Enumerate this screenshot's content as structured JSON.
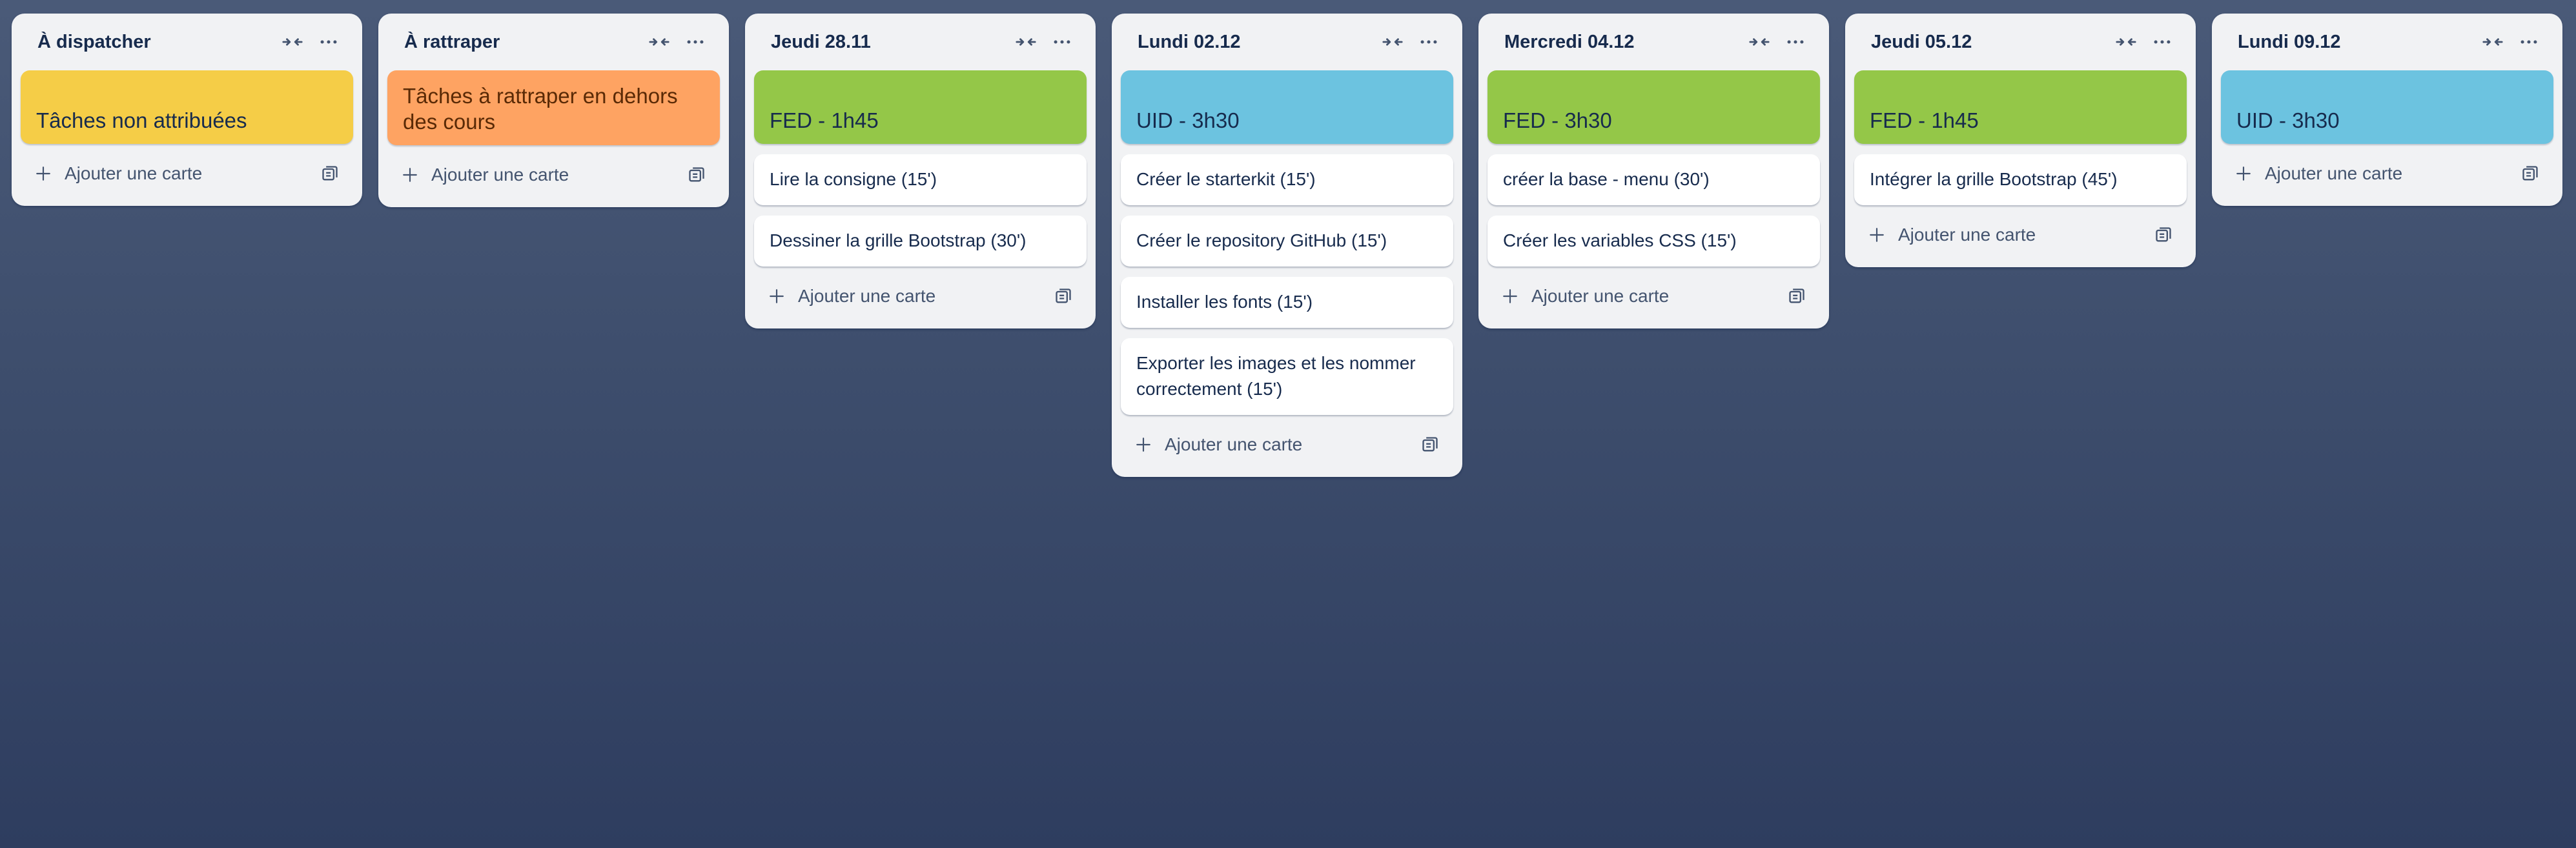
{
  "board": {
    "lists": [
      {
        "title": "À dispatcher",
        "cover": {
          "text": "Tâches non attribuées",
          "color": "#f5cd47"
        },
        "cards": [],
        "add_label": "Ajouter une carte"
      },
      {
        "title": "À rattraper",
        "cover": {
          "text": "Tâches à rattraper en dehors des cours",
          "color": "#fea362"
        },
        "cards": [],
        "add_label": "Ajouter une carte"
      },
      {
        "title": "Jeudi 28.11",
        "cover": {
          "text": "FED - 1h45",
          "color": "#94c748"
        },
        "cards": [
          "Lire la consigne (15')",
          "Dessiner la grille Bootstrap (30')"
        ],
        "add_label": "Ajouter une carte"
      },
      {
        "title": "Lundi 02.12",
        "cover": {
          "text": "UID - 3h30",
          "color": "#6cc3e0"
        },
        "cards": [
          "Créer le starterkit (15')",
          "Créer le repository GitHub (15')",
          "Installer les fonts (15')",
          "Exporter les images et les nommer correctement (15')"
        ],
        "add_label": "Ajouter une carte"
      },
      {
        "title": "Mercredi 04.12",
        "cover": {
          "text": "FED - 3h30",
          "color": "#94c748"
        },
        "cards": [
          "créer la base - menu (30')",
          "Créer les variables CSS (15')"
        ],
        "add_label": "Ajouter une carte"
      },
      {
        "title": "Jeudi 05.12",
        "cover": {
          "text": "FED - 1h45",
          "color": "#94c748"
        },
        "cards": [
          "Intégrer la grille Bootstrap (45')"
        ],
        "add_label": "Ajouter une carte"
      },
      {
        "title": "Lundi 09.12",
        "cover": {
          "text": "UID - 3h30",
          "color": "#6cc3e0"
        },
        "cards": [],
        "add_label": "Ajouter une carte"
      }
    ],
    "icons": {
      "collapse": "collapse-list-icon",
      "more": "more-options-icon",
      "add": "plus-icon",
      "template": "card-template-icon"
    }
  }
}
